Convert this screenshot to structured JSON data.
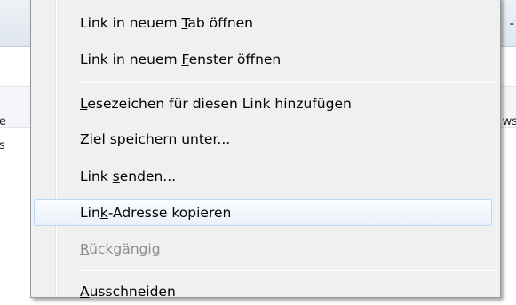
{
  "background": {
    "fragment_top_right": "-",
    "fragment_e": "e",
    "fragment_s": "s",
    "fragment_ws": "ws"
  },
  "menu": {
    "items": [
      {
        "before": "Link in neuem ",
        "mnemonic": "T",
        "after": "ab öffnen",
        "disabled": false,
        "highlighted": false
      },
      {
        "before": "Link in neuem ",
        "mnemonic": "F",
        "after": "enster öffnen",
        "disabled": false,
        "highlighted": false
      },
      {
        "before": "",
        "mnemonic": "L",
        "after": "esezeichen für diesen Link hinzufügen",
        "disabled": false,
        "highlighted": false
      },
      {
        "before": "",
        "mnemonic": "Z",
        "after": "iel speichern unter...",
        "disabled": false,
        "highlighted": false
      },
      {
        "before": "Link ",
        "mnemonic": "s",
        "after": "enden...",
        "disabled": false,
        "highlighted": false
      },
      {
        "before": "Lin",
        "mnemonic": "k",
        "after": "-Adresse kopieren",
        "disabled": false,
        "highlighted": true
      },
      {
        "before": "",
        "mnemonic": "R",
        "after": "ückgängig",
        "disabled": true,
        "highlighted": false
      },
      {
        "before": "",
        "mnemonic": "A",
        "after": "usschneiden",
        "disabled": false,
        "highlighted": false
      }
    ]
  },
  "colors": {
    "menu_background": "#f0f0f0",
    "highlight_border": "#b8d6fb",
    "disabled_text": "#8d8d8d"
  }
}
